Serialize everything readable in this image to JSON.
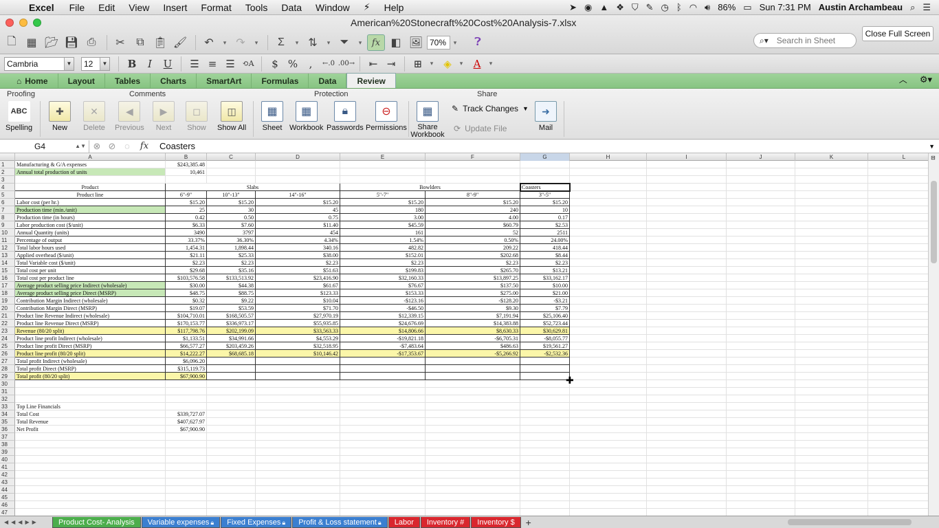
{
  "menubar": {
    "app": "Excel",
    "items": [
      "File",
      "Edit",
      "View",
      "Insert",
      "Format",
      "Tools",
      "Data",
      "Window",
      "Help"
    ],
    "battery": "86%",
    "clock": "Sun 7:31 PM",
    "user": "Austin Archambeau"
  },
  "window": {
    "title": "American%20Stonecraft%20Cost%20Analysis-7.xlsx",
    "close_fullscreen": "Close Full Screen",
    "zoom": "70%",
    "search_placeholder": "Search in Sheet"
  },
  "format": {
    "font_name": "Cambria",
    "font_size": "12"
  },
  "ribbon_tabs": [
    "Home",
    "Layout",
    "Tables",
    "Charts",
    "SmartArt",
    "Formulas",
    "Data",
    "Review"
  ],
  "active_tab": "Review",
  "ribbon": {
    "groups": {
      "proofing": "Proofing",
      "comments": "Comments",
      "protection": "Protection",
      "share": "Share"
    },
    "spelling": "Spelling",
    "spelling_icon": "ABC",
    "new": "New",
    "delete": "Delete",
    "previous": "Previous",
    "next": "Next",
    "show": "Show",
    "show_all": "Show All",
    "sheet": "Sheet",
    "workbook": "Workbook",
    "passwords": "Passwords",
    "permissions": "Permissions",
    "share_workbook": "Share Workbook",
    "track_changes": "Track Changes",
    "update_file": "Update File",
    "mail": "Mail"
  },
  "formula_bar": {
    "cell_ref": "G4",
    "value": "Coasters"
  },
  "columns": [
    "A",
    "B",
    "C",
    "D",
    "E",
    "F",
    "G",
    "H",
    "I",
    "J",
    "K",
    "L"
  ],
  "rows": [
    [
      "Manufacturing & G/A expenses",
      "$243,385.48",
      "",
      "",
      "",
      "",
      "",
      "",
      "",
      "",
      "",
      ""
    ],
    [
      "Annual total production of units",
      "10,461",
      "",
      "",
      "",
      "",
      "",
      "",
      "",
      "",
      "",
      ""
    ],
    [
      "",
      "",
      "",
      "",
      "",
      "",
      "",
      "",
      "",
      "",
      "",
      ""
    ],
    [
      "Product",
      "",
      "Slabs",
      "",
      "",
      "Bowlders",
      "Coasters",
      "",
      "",
      "",
      "",
      ""
    ],
    [
      "Product line",
      "6\"-9\"",
      "10\"-13\"",
      "14\"-16\"",
      "5\"-7\"",
      "8\"-9\"",
      "3\"-5\"",
      "",
      "",
      "",
      "",
      ""
    ],
    [
      "Labor cost (per hr.)",
      "$15.20",
      "$15.20",
      "$15.20",
      "$15.20",
      "$15.20",
      "$15.20",
      "",
      "",
      "",
      "",
      ""
    ],
    [
      "Production time (min./unit)",
      "25",
      "30",
      "45",
      "180",
      "240",
      "10",
      "",
      "",
      "",
      "",
      ""
    ],
    [
      "Production time (in hours)",
      "0.42",
      "0.50",
      "0.75",
      "3.00",
      "4.00",
      "0.17",
      "",
      "",
      "",
      "",
      ""
    ],
    [
      "Labor production cost ($/unit)",
      "$6.33",
      "$7.60",
      "$11.40",
      "$45.59",
      "$60.79",
      "$2.53",
      "",
      "",
      "",
      "",
      ""
    ],
    [
      "Annual Quantity (units)",
      "3490",
      "3797",
      "454",
      "161",
      "52",
      "2511",
      "",
      "",
      "",
      "",
      ""
    ],
    [
      "Percentage of output",
      "33.37%",
      "36.30%",
      "4.34%",
      "1.54%",
      "0.50%",
      "24.00%",
      "",
      "",
      "",
      "",
      ""
    ],
    [
      "Total labor hours used",
      "1,454.31",
      "1,898.44",
      "340.16",
      "482.82",
      "209.22",
      "418.44",
      "",
      "",
      "",
      "",
      ""
    ],
    [
      "Applied overhead ($/unit)",
      "$21.11",
      "$25.33",
      "$38.00",
      "$152.01",
      "$202.68",
      "$8.44",
      "",
      "",
      "",
      "",
      ""
    ],
    [
      "Total Variable cost ($/unit)",
      "$2.23",
      "$2.23",
      "$2.23",
      "$2.23",
      "$2.23",
      "$2.23",
      "",
      "",
      "",
      "",
      ""
    ],
    [
      "Total cost per unit",
      "$29.68",
      "$35.16",
      "$51.63",
      "$199.83",
      "$265.70",
      "$13.21",
      "",
      "",
      "",
      "",
      ""
    ],
    [
      "Total cost per product line",
      "$103,576.58",
      "$133,513.92",
      "$23,416.90",
      "$32,160.33",
      "$13,897.25",
      "$33,162.17",
      "",
      "",
      "",
      "",
      ""
    ],
    [
      "Average product selling price Indirect (wholesale)",
      "$30.00",
      "$44.38",
      "$61.67",
      "$76.67",
      "$137.50",
      "$10.00",
      "",
      "",
      "",
      "",
      ""
    ],
    [
      "Average product selling price Direct (MSRP)",
      "$48.75",
      "$88.75",
      "$123.33",
      "$153.33",
      "$275.00",
      "$21.00",
      "",
      "",
      "",
      "",
      ""
    ],
    [
      "Contribution Margin Indirect (wholesale)",
      "$0.32",
      "$9.22",
      "$10.04",
      "-$123.16",
      "-$128.20",
      "-$3.21",
      "",
      "",
      "",
      "",
      ""
    ],
    [
      "Contribution Margin Direct (MSRP)",
      "$19.07",
      "$53.59",
      "$71.70",
      "-$46.50",
      "$9.30",
      "$7.79",
      "",
      "",
      "",
      "",
      ""
    ],
    [
      "Product line Revenue Indirect (wholesale)",
      "$104,710.01",
      "$168,505.57",
      "$27,970.19",
      "$12,339.15",
      "$7,191.94",
      "$25,106.40",
      "",
      "",
      "",
      "",
      ""
    ],
    [
      "Product line Revenue Direct (MSRP)",
      "$170,153.77",
      "$336,973.17",
      "$55,935.85",
      "$24,676.69",
      "$14,383.88",
      "$52,723.44",
      "",
      "",
      "",
      "",
      ""
    ],
    [
      "Revenue (80/20 split)",
      "$117,798.76",
      "$202,199.09",
      "$33,563.33",
      "$14,806.66",
      "$8,630.33",
      "$30,629.81",
      "",
      "",
      "",
      "",
      ""
    ],
    [
      "Product line profit Indirect (wholesale)",
      "$1,133.51",
      "$34,991.66",
      "$4,553.29",
      "-$19,821.18",
      "-$6,705.31",
      "-$8,055.77",
      "",
      "",
      "",
      "",
      ""
    ],
    [
      "Product line profit Direct (MSRP)",
      "$66,577.27",
      "$203,459.26",
      "$32,518.95",
      "-$7,483.64",
      "$486.63",
      "$19,561.27",
      "",
      "",
      "",
      "",
      ""
    ],
    [
      "Product line profit (80/20 split)",
      "$14,222.27",
      "$68,685.18",
      "$10,146.42",
      "-$17,353.67",
      "-$5,266.92",
      "-$2,532.36",
      "",
      "",
      "",
      "",
      ""
    ],
    [
      "Total profit Indirect (wholesale)",
      "$6,096.20",
      "",
      "",
      "",
      "",
      "",
      "",
      "",
      "",
      "",
      ""
    ],
    [
      "Total profit Direct (MSRP)",
      "$315,119.73",
      "",
      "",
      "",
      "",
      "",
      "",
      "",
      "",
      "",
      ""
    ],
    [
      "Total profit (80/20 split)",
      "$67,900.90",
      "",
      "",
      "",
      "",
      "",
      "",
      "",
      "",
      "",
      ""
    ],
    [
      "",
      "",
      "",
      "",
      "",
      "",
      "",
      "",
      "",
      "",
      "",
      ""
    ],
    [
      "",
      "",
      "",
      "",
      "",
      "",
      "",
      "",
      "",
      "",
      "",
      ""
    ],
    [
      "",
      "",
      "",
      "",
      "",
      "",
      "",
      "",
      "",
      "",
      "",
      ""
    ],
    [
      "Top Line Financials",
      "",
      "",
      "",
      "",
      "",
      "",
      "",
      "",
      "",
      "",
      ""
    ],
    [
      "Total Cost",
      "$339,727.07",
      "",
      "",
      "",
      "",
      "",
      "",
      "",
      "",
      "",
      ""
    ],
    [
      "Total Revenue",
      "$407,627.97",
      "",
      "",
      "",
      "",
      "",
      "",
      "",
      "",
      "",
      ""
    ],
    [
      "Net Profit",
      "$67,900.90",
      "",
      "",
      "",
      "",
      "",
      "",
      "",
      "",
      "",
      ""
    ]
  ],
  "green_rows": [
    2,
    7,
    17,
    18
  ],
  "yellow_rows": [
    23,
    26,
    29
  ],
  "sheet_tabs": [
    {
      "label": "Product Cost- Analysis",
      "color": "#4cae4c",
      "locked": false
    },
    {
      "label": "Variable expenses",
      "color": "#3b7fd0",
      "locked": true
    },
    {
      "label": "Fixed Expenses",
      "color": "#3b7fd0",
      "locked": true
    },
    {
      "label": "Profit & Loss statement",
      "color": "#3b7fd0",
      "locked": true
    },
    {
      "label": "Labor",
      "color": "#d9272e",
      "locked": false
    },
    {
      "label": "Inventory #",
      "color": "#d9272e",
      "locked": false
    },
    {
      "label": "Inventory $",
      "color": "#d9272e",
      "locked": false
    }
  ]
}
